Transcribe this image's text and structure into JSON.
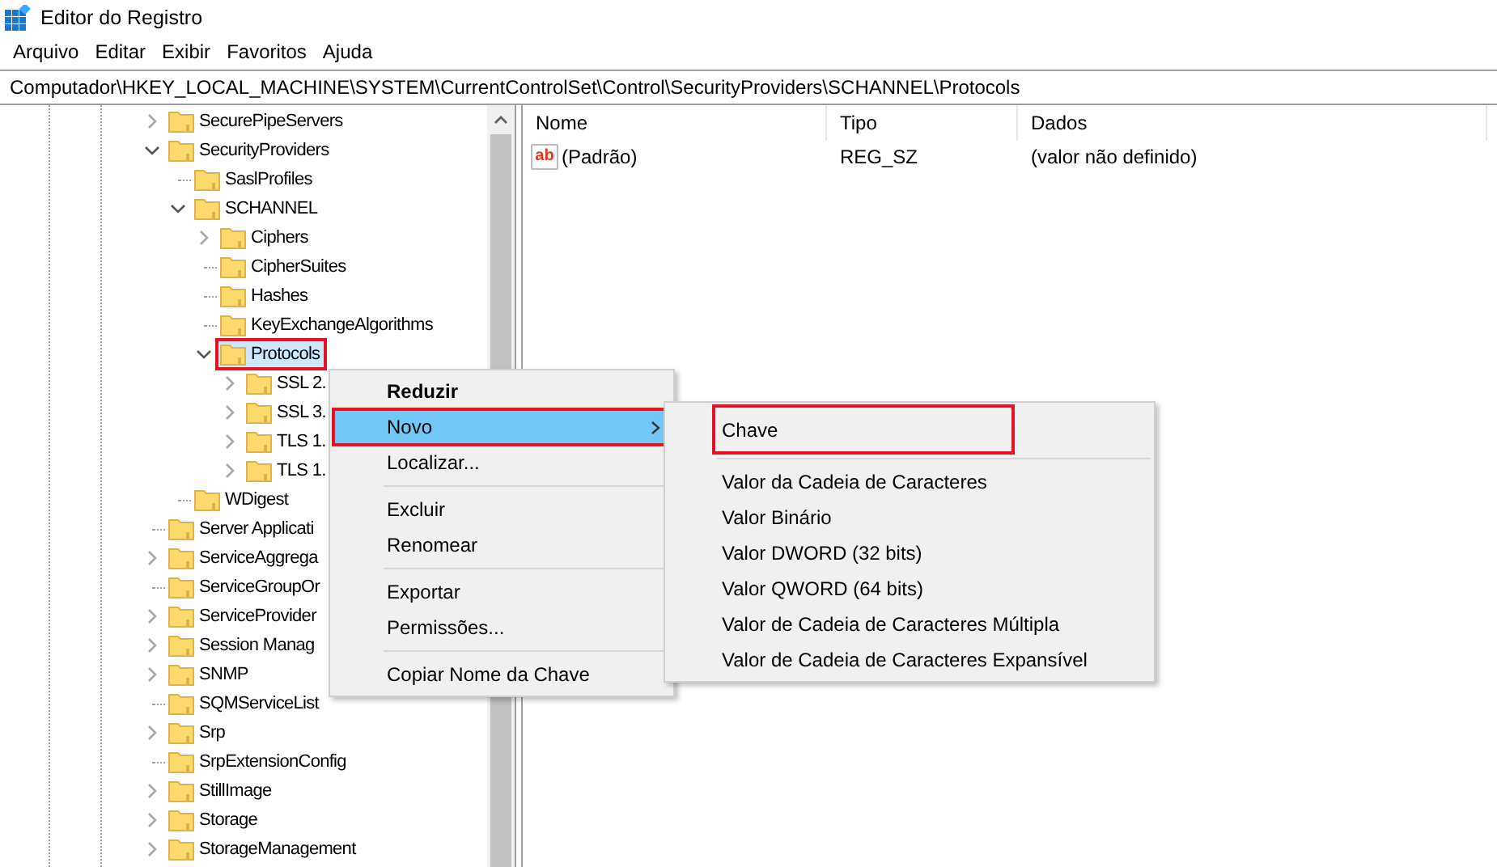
{
  "window": {
    "title": "Editor do Registro"
  },
  "menu": [
    "Arquivo",
    "Editar",
    "Exibir",
    "Favoritos",
    "Ajuda"
  ],
  "address": "Computador\\HKEY_LOCAL_MACHINE\\SYSTEM\\CurrentControlSet\\Control\\SecurityProviders\\SCHANNEL\\Protocols",
  "tree": [
    {
      "label": "SecurePipeServers",
      "kind": "branch",
      "expanded": false,
      "selected": false,
      "annotated": false
    },
    {
      "label": "SecurityProviders",
      "kind": "branch",
      "expanded": true,
      "selected": false,
      "annotated": false,
      "children": [
        {
          "label": "SaslProfiles",
          "kind": "leaf",
          "selected": false,
          "annotated": false
        },
        {
          "label": "SCHANNEL",
          "kind": "branch",
          "expanded": true,
          "selected": false,
          "annotated": false,
          "children": [
            {
              "label": "Ciphers",
              "kind": "branch",
              "expanded": false,
              "selected": false,
              "annotated": false
            },
            {
              "label": "CipherSuites",
              "kind": "leaf",
              "selected": false,
              "annotated": false
            },
            {
              "label": "Hashes",
              "kind": "leaf",
              "selected": false,
              "annotated": false
            },
            {
              "label": "KeyExchangeAlgorithms",
              "kind": "leaf",
              "selected": false,
              "annotated": false
            },
            {
              "label": "Protocols",
              "kind": "branch",
              "expanded": true,
              "selected": true,
              "annotated": true,
              "children": [
                {
                  "label": "SSL 2.",
                  "kind": "branch",
                  "expanded": false,
                  "selected": false,
                  "annotated": false
                },
                {
                  "label": "SSL 3.",
                  "kind": "branch",
                  "expanded": false,
                  "selected": false,
                  "annotated": false
                },
                {
                  "label": "TLS 1.",
                  "kind": "branch",
                  "expanded": false,
                  "selected": false,
                  "annotated": false
                },
                {
                  "label": "TLS 1.",
                  "kind": "branch",
                  "expanded": false,
                  "selected": false,
                  "annotated": false
                }
              ]
            }
          ]
        },
        {
          "label": "WDigest",
          "kind": "leaf",
          "selected": false,
          "annotated": false
        }
      ]
    },
    {
      "label": "Server Applicati",
      "kind": "leaf",
      "selected": false,
      "annotated": false
    },
    {
      "label": "ServiceAggrega",
      "kind": "branch",
      "expanded": false,
      "selected": false,
      "annotated": false
    },
    {
      "label": "ServiceGroupOr",
      "kind": "leaf",
      "selected": false,
      "annotated": false
    },
    {
      "label": "ServiceProvider",
      "kind": "branch",
      "expanded": false,
      "selected": false,
      "annotated": false
    },
    {
      "label": "Session Manag",
      "kind": "branch",
      "expanded": false,
      "selected": false,
      "annotated": false
    },
    {
      "label": "SNMP",
      "kind": "branch",
      "expanded": false,
      "selected": false,
      "annotated": false
    },
    {
      "label": "SQMServiceList",
      "kind": "leaf",
      "selected": false,
      "annotated": false
    },
    {
      "label": "Srp",
      "kind": "branch",
      "expanded": false,
      "selected": false,
      "annotated": false
    },
    {
      "label": "SrpExtensionConfig",
      "kind": "leaf",
      "selected": false,
      "annotated": false
    },
    {
      "label": "StillImage",
      "kind": "branch",
      "expanded": false,
      "selected": false,
      "annotated": false
    },
    {
      "label": "Storage",
      "kind": "branch",
      "expanded": false,
      "selected": false,
      "annotated": false
    },
    {
      "label": "StorageManagement",
      "kind": "branch",
      "expanded": false,
      "selected": false,
      "annotated": false
    }
  ],
  "list": {
    "columns": [
      "Nome",
      "Tipo",
      "Dados"
    ],
    "rows": [
      {
        "icon_text": "ab",
        "name": "(Padrão)",
        "type": "REG_SZ",
        "data": "(valor não definido)"
      }
    ]
  },
  "context_menu": [
    {
      "kind": "item",
      "label": "Reduzir",
      "bold": true,
      "hover": false,
      "annotated": false,
      "submenu": false
    },
    {
      "kind": "item",
      "label": "Novo",
      "bold": false,
      "hover": true,
      "annotated": true,
      "submenu": true
    },
    {
      "kind": "item",
      "label": "Localizar...",
      "bold": false,
      "hover": false,
      "annotated": false,
      "submenu": false
    },
    {
      "kind": "separator"
    },
    {
      "kind": "item",
      "label": "Excluir",
      "bold": false,
      "hover": false,
      "annotated": false,
      "submenu": false
    },
    {
      "kind": "item",
      "label": "Renomear",
      "bold": false,
      "hover": false,
      "annotated": false,
      "submenu": false
    },
    {
      "kind": "separator"
    },
    {
      "kind": "item",
      "label": "Exportar",
      "bold": false,
      "hover": false,
      "annotated": false,
      "submenu": false
    },
    {
      "kind": "item",
      "label": "Permissões...",
      "bold": false,
      "hover": false,
      "annotated": false,
      "submenu": false
    },
    {
      "kind": "separator"
    },
    {
      "kind": "item",
      "label": "Copiar Nome da Chave",
      "bold": false,
      "hover": false,
      "annotated": false,
      "submenu": false
    }
  ],
  "submenu": [
    {
      "kind": "item",
      "label": "Chave",
      "annotated": true
    },
    {
      "kind": "separator"
    },
    {
      "kind": "item",
      "label": "Valor da Cadeia de Caracteres",
      "annotated": false
    },
    {
      "kind": "item",
      "label": "Valor Binário",
      "annotated": false
    },
    {
      "kind": "item",
      "label": "Valor DWORD (32 bits)",
      "annotated": false
    },
    {
      "kind": "item",
      "label": "Valor QWORD (64 bits)",
      "annotated": false
    },
    {
      "kind": "item",
      "label": "Valor de Cadeia de Caracteres Múltipla",
      "annotated": false
    },
    {
      "kind": "item",
      "label": "Valor de Cadeia de Caracteres Expansível",
      "annotated": false
    }
  ]
}
